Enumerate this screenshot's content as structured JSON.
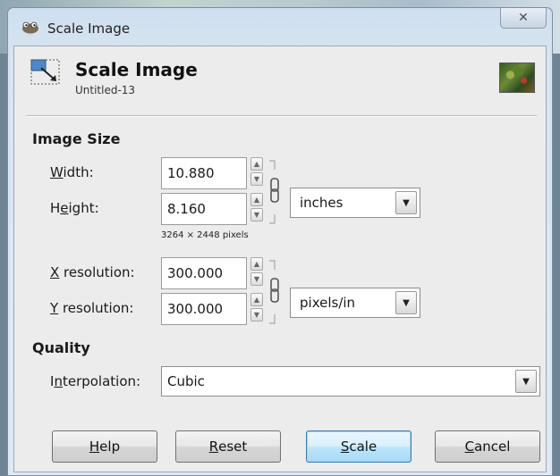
{
  "window": {
    "title": "Scale Image",
    "close_glyph": "✕"
  },
  "header": {
    "title": "Scale Image",
    "subtitle": "Untitled-13",
    "icon": "scale-image-icon",
    "thumbnail": "image-thumbnail"
  },
  "image_size": {
    "section_label": "Image Size",
    "width": {
      "label_prefix": "",
      "label_key": "W",
      "label_rest": "idth:",
      "value": "10.880"
    },
    "height": {
      "label_prefix": "H",
      "label_key": "e",
      "label_rest": "ight:",
      "value": "8.160"
    },
    "unit": "inches",
    "pixels_info": "3264 × 2448 pixels",
    "x_res": {
      "label_key": "X",
      "label_rest": " resolution:",
      "value": "300.000"
    },
    "y_res": {
      "label_key": "Y",
      "label_rest": " resolution:",
      "value": "300.000"
    },
    "res_unit": "pixels/in"
  },
  "quality": {
    "section_label": "Quality",
    "interp_prefix": "I",
    "interp_key": "n",
    "interp_rest": "terpolation:",
    "value": "Cubic"
  },
  "buttons": {
    "help": {
      "key": "H",
      "rest": "elp"
    },
    "reset": {
      "key": "R",
      "rest": "eset"
    },
    "scale": {
      "key": "S",
      "rest": "cale"
    },
    "cancel": {
      "key": "C",
      "rest": "ancel"
    }
  },
  "icons": {
    "spin_up": "▲",
    "spin_down": "▼",
    "dropdown": "▼"
  }
}
